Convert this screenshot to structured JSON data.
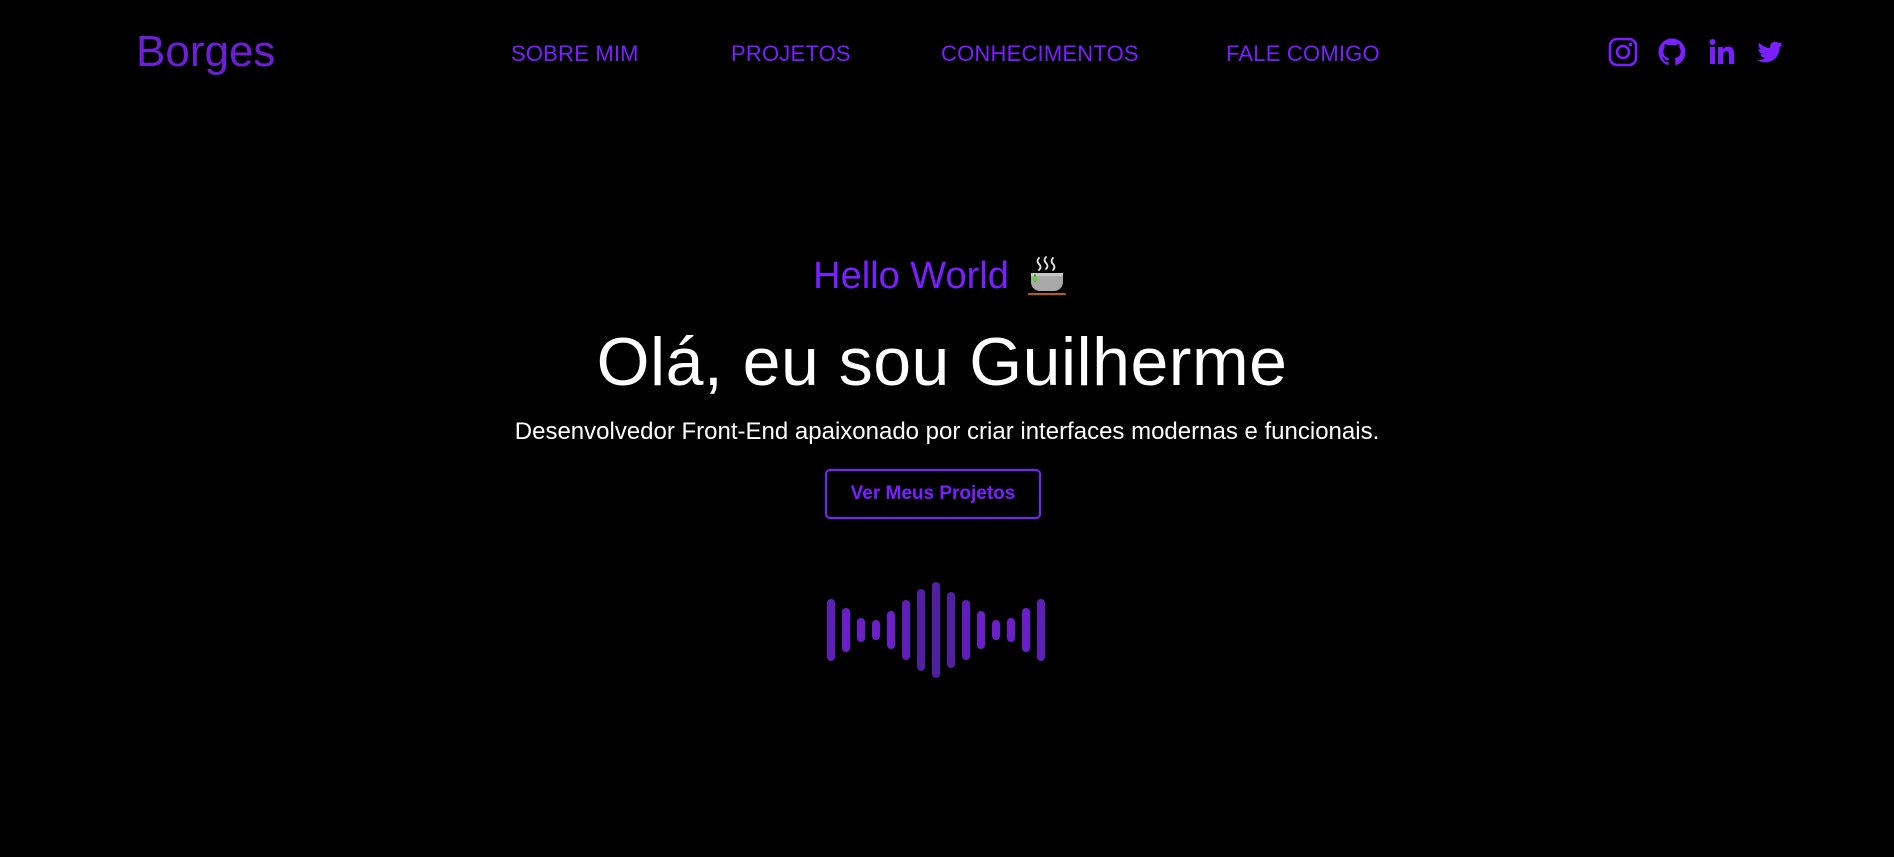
{
  "header": {
    "brand": "Borges",
    "nav": [
      {
        "label": "SOBRE MIM"
      },
      {
        "label": "PROJETOS"
      },
      {
        "label": "CONHECIMENTOS"
      },
      {
        "label": "FALE COMIGO"
      }
    ],
    "social_icons": [
      "instagram-icon",
      "github-icon",
      "linkedin-icon",
      "twitter-icon"
    ]
  },
  "hero": {
    "greeting": "Hello World",
    "greeting_icon": "coffee-cup-icon",
    "title": "Olá, eu sou Guilherme",
    "subtitle": "Desenvolvedor Front-End apaixonado por criar interfaces modernas e funcionais.",
    "cta_label": "Ver Meus Projetos",
    "decoration_icon": "sound-wave-icon"
  },
  "colors": {
    "background": "#000000",
    "accent": "#7a1fff",
    "brand": "#6d1fd6",
    "text": "#ffffff",
    "wave": "#5e1fb8"
  }
}
